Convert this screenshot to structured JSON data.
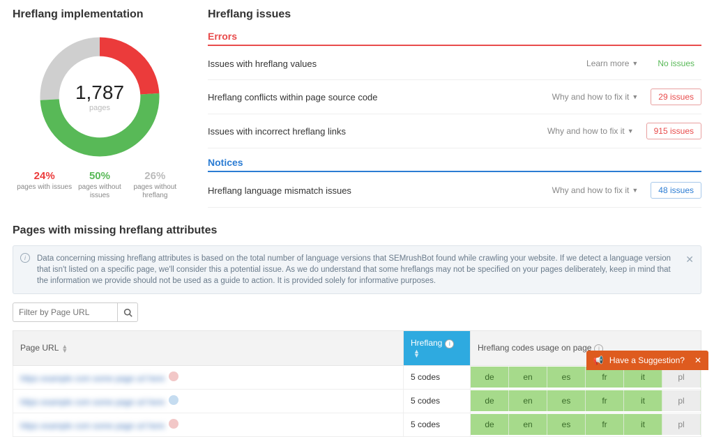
{
  "impl": {
    "heading": "Hreflang implementation",
    "total": "1,787",
    "total_unit": "pages",
    "legend": [
      {
        "pct": "24%",
        "label": "pages with issues",
        "cls": "c-red"
      },
      {
        "pct": "50%",
        "label": "pages without issues",
        "cls": "c-green"
      },
      {
        "pct": "26%",
        "label": "pages without hreflang",
        "cls": "c-grey"
      }
    ]
  },
  "issues": {
    "heading": "Hreflang issues",
    "errors_label": "Errors",
    "notices_label": "Notices",
    "learn_more": "Learn more",
    "why_fix": "Why and how to fix it",
    "rows_errors": [
      {
        "name": "Issues with hreflang values",
        "link": "learn",
        "badge": "No issues",
        "badge_cls": "badge-none"
      },
      {
        "name": "Hreflang conflicts within page source code",
        "link": "why",
        "badge": "29 issues",
        "badge_cls": "badge-err"
      },
      {
        "name": "Issues with incorrect hreflang links",
        "link": "why",
        "badge": "915 issues",
        "badge_cls": "badge-err"
      }
    ],
    "rows_notices": [
      {
        "name": "Hreflang language mismatch issues",
        "link": "why",
        "badge": "48 issues",
        "badge_cls": "badge-notice"
      }
    ]
  },
  "missing": {
    "heading": "Pages with missing hreflang attributes",
    "info": "Data concerning missing hreflang attributes is based on the total number of language versions that SEMrushBot found while crawling your website. If we detect a language version that isn't listed on a specific page, we'll consider this a potential issue. As we do understand that some hreflangs may not be specified on your pages deliberately, keep in mind that the information we provide should not be used as a guide to action. It is provided solely for informative purposes.",
    "filter_placeholder": "Filter by Page URL",
    "col_page": "Page URL",
    "col_hreflang": "Hreflang",
    "col_usage": "Hreflang codes usage on page",
    "rows": [
      {
        "count": "5 codes",
        "codes": [
          "de",
          "en",
          "es",
          "fr",
          "it",
          "pl"
        ],
        "on": [
          true,
          true,
          true,
          true,
          true,
          false
        ],
        "ico": "red"
      },
      {
        "count": "5 codes",
        "codes": [
          "de",
          "en",
          "es",
          "fr",
          "it",
          "pl"
        ],
        "on": [
          true,
          true,
          true,
          true,
          true,
          false
        ],
        "ico": "blue"
      },
      {
        "count": "5 codes",
        "codes": [
          "de",
          "en",
          "es",
          "fr",
          "it",
          "pl"
        ],
        "on": [
          true,
          true,
          true,
          true,
          true,
          false
        ],
        "ico": "red"
      }
    ]
  },
  "chart_data": {
    "type": "pie",
    "title": "Hreflang implementation",
    "categories": [
      "pages with issues",
      "pages without issues",
      "pages without hreflang"
    ],
    "values": [
      24,
      50,
      26
    ],
    "colors": [
      "#eb3b3b",
      "#58b957",
      "#cfcfcf"
    ],
    "total_label": "1,787 pages"
  },
  "suggestion": {
    "label": "Have a Suggestion?"
  }
}
